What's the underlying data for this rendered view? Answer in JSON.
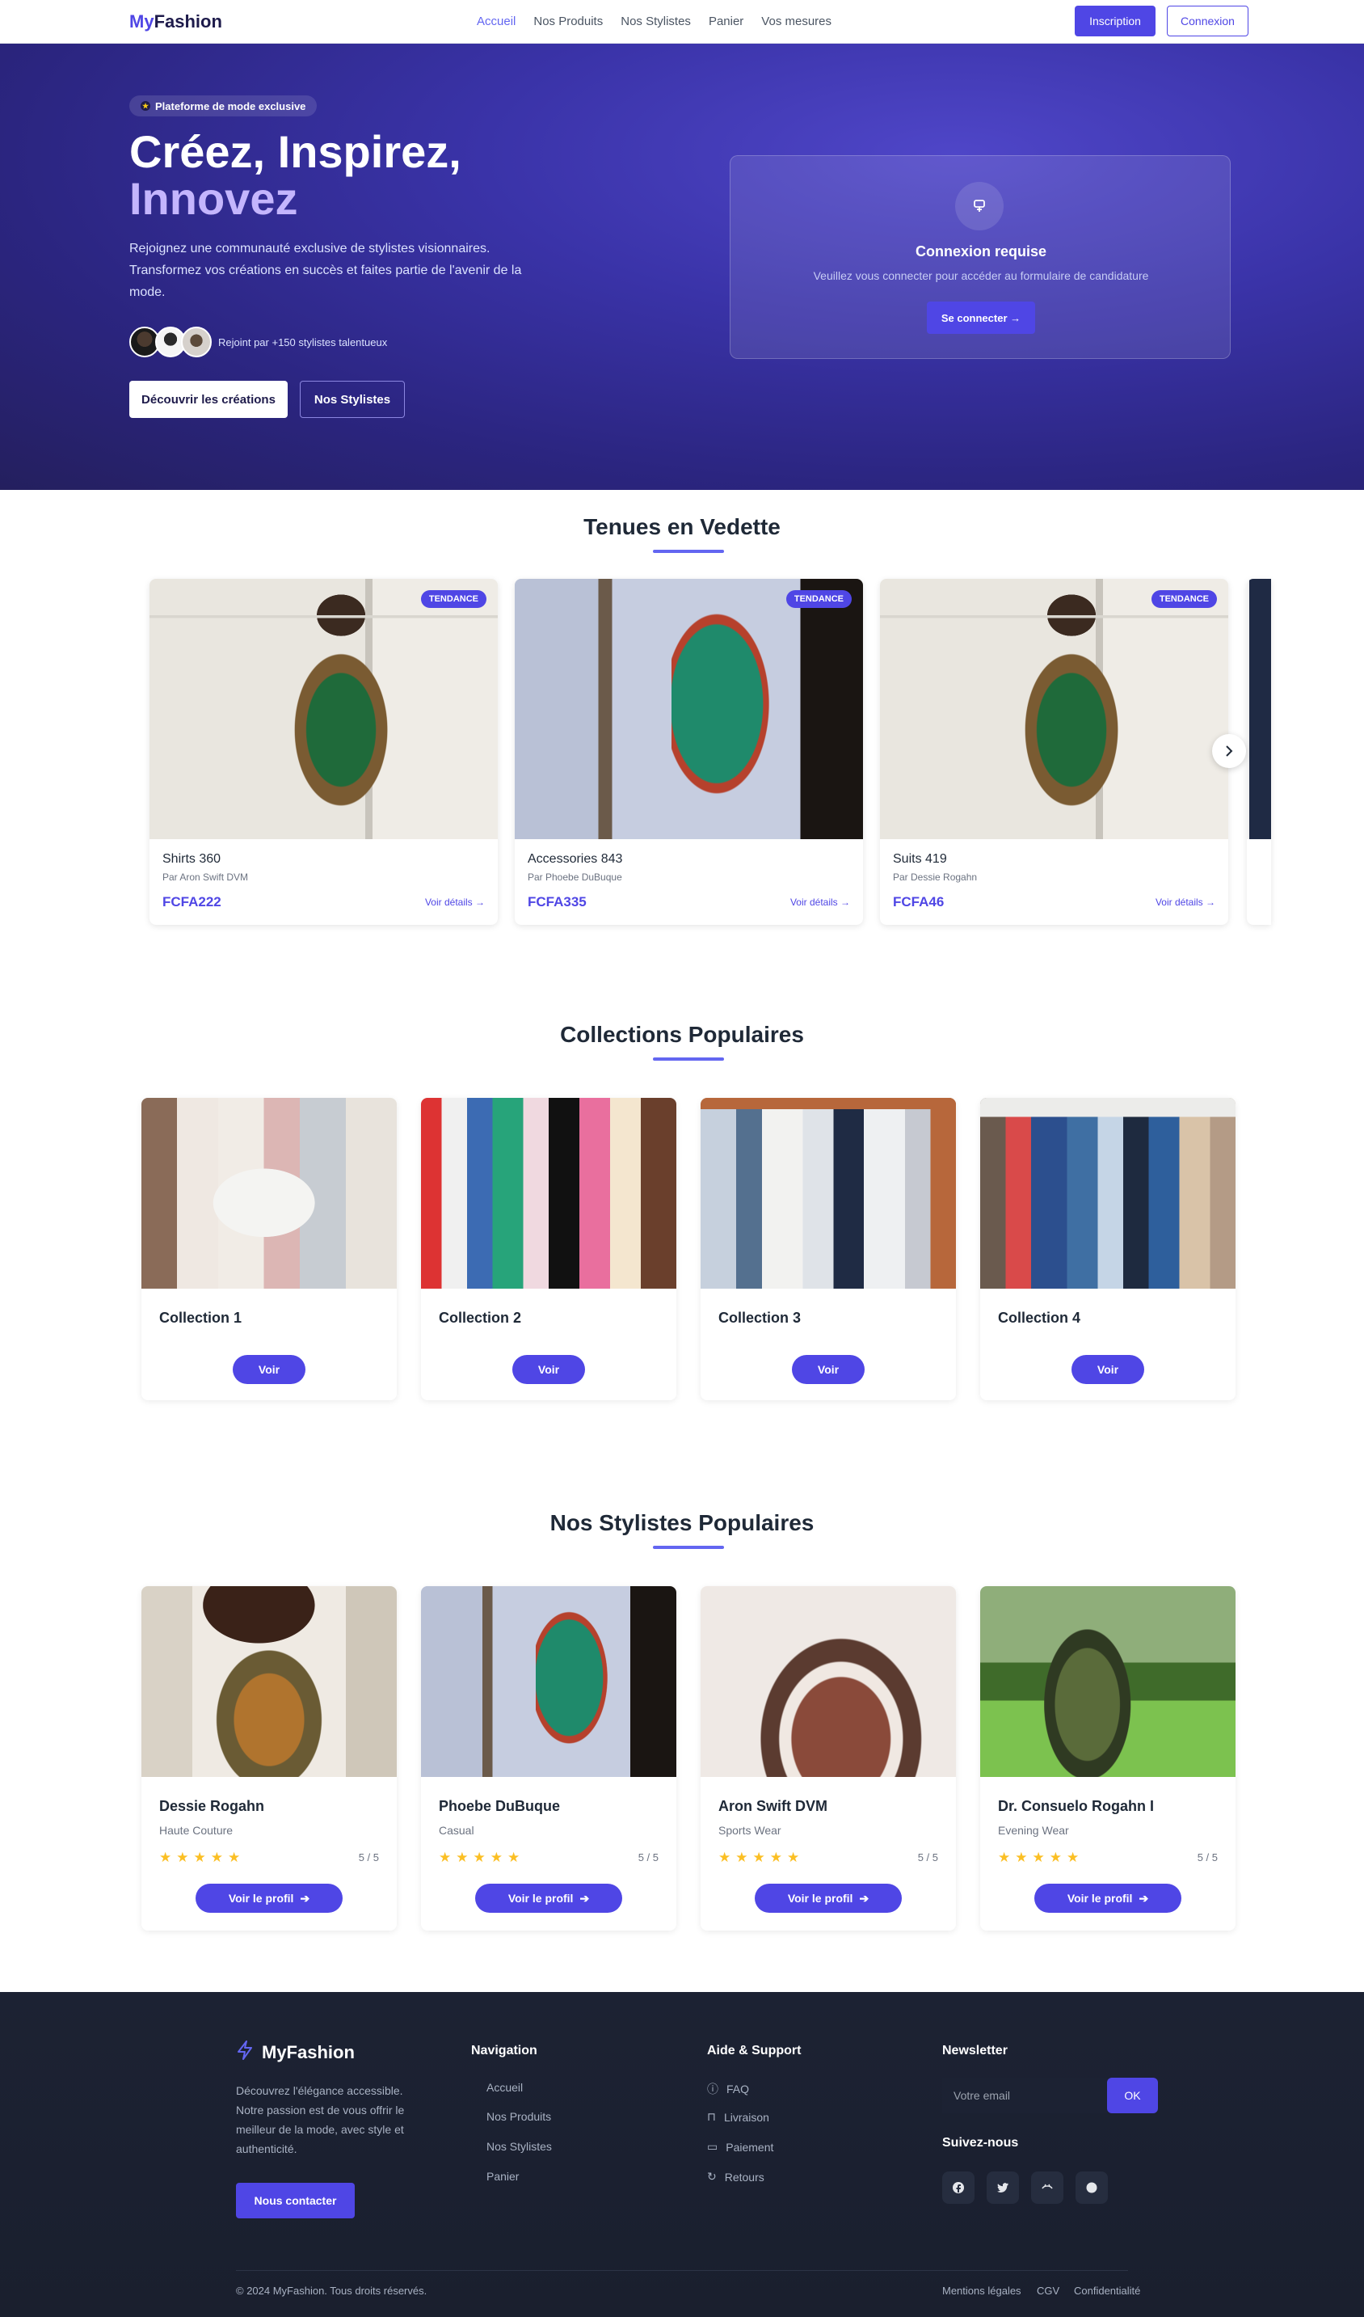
{
  "navbar": {
    "brand_a": "My",
    "brand_b": "Fashion",
    "links": [
      "Accueil",
      "Nos Produits",
      "Nos Stylistes",
      "Panier",
      "Vos mesures"
    ],
    "signup": "Inscription",
    "login": "Connexion"
  },
  "hero": {
    "badge": "Plateforme de mode exclusive",
    "title_line1": "Créez, Inspirez,",
    "title_line2": "Innovez",
    "text": "Rejoignez une communauté exclusive de stylistes visionnaires. Transformez vos créations en succès et faites partie de l'avenir de la mode.",
    "joined": "Rejoint par +150 stylistes talentueux",
    "btn_discover": "Découvrir les créations",
    "btn_stylists": "Nos Stylistes",
    "card": {
      "title": "Connexion requise",
      "subtitle": "Veuillez vous connecter pour accéder au formulaire de candidature",
      "button": "Se connecter →"
    }
  },
  "featured": {
    "title": "Tenues en Vedette",
    "items": [
      {
        "tag": "TENDANCE",
        "name": "Shirts 360",
        "by": "Par Aron Swift DVM",
        "price": "FCFA222",
        "link": "Voir détails →"
      },
      {
        "tag": "TENDANCE",
        "name": "Accessories 843",
        "by": "Par Phoebe DuBuque",
        "price": "FCFA335",
        "link": "Voir détails →"
      },
      {
        "tag": "TENDANCE",
        "name": "Suits 419",
        "by": "Par Dessie Rogahn",
        "price": "FCFA46",
        "link": "Voir détails →"
      }
    ]
  },
  "collections": {
    "title": "Collections Populaires",
    "items": [
      {
        "name": "Collection 1",
        "button": "Voir"
      },
      {
        "name": "Collection 2",
        "button": "Voir"
      },
      {
        "name": "Collection 3",
        "button": "Voir"
      },
      {
        "name": "Collection 4",
        "button": "Voir"
      }
    ]
  },
  "stylists": {
    "title": "Nos Stylistes Populaires",
    "items": [
      {
        "name": "Dessie Rogahn",
        "specialty": "Haute Couture",
        "stars": "★★★★★",
        "rating": "5 / 5",
        "button": "Voir le profil"
      },
      {
        "name": "Phoebe DuBuque",
        "specialty": "Casual",
        "stars": "★★★★★",
        "rating": "5 / 5",
        "button": "Voir le profil"
      },
      {
        "name": "Aron Swift DVM",
        "specialty": "Sports Wear",
        "stars": "★★★★★",
        "rating": "5 / 5",
        "button": "Voir le profil"
      },
      {
        "name": "Dr. Consuelo Rogahn I",
        "specialty": "Evening Wear",
        "stars": "★★★★★",
        "rating": "5 / 5",
        "button": "Voir le profil"
      }
    ]
  },
  "footer": {
    "brand": "MyFashion",
    "description": "Découvrez l'élégance accessible. Notre passion est de vous offrir le meilleur de la mode, avec style et authenticité.",
    "contact": "Nous contacter",
    "nav_title": "Navigation",
    "nav_links": [
      "Accueil",
      "Nos Produits",
      "Nos Stylistes",
      "Panier"
    ],
    "help_title": "Aide & Support",
    "help_links": [
      "FAQ",
      "Livraison",
      "Paiement",
      "Retours"
    ],
    "newsletter_title": "Newsletter",
    "newsletter_placeholder": "Votre email",
    "newsletter_button": "OK",
    "follow_title": "Suivez-nous",
    "copyright": "© 2024 MyFashion. Tous droits réservés.",
    "legal": [
      "Mentions légales",
      "CGV",
      "Confidentialité"
    ]
  },
  "colors": {
    "accent": "#4f46e5",
    "hero_bg": "#2b2580",
    "footer_bg": "#1c2233",
    "star": "#fbbf24"
  }
}
